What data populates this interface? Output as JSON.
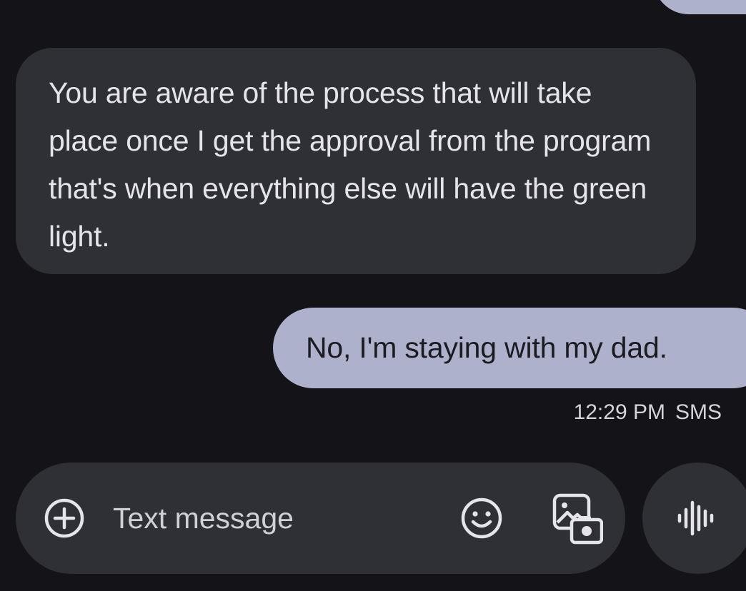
{
  "conversation": {
    "messages": [
      {
        "direction": "incoming",
        "text": "You are aware of the process that will take place once I get the approval from the program that's when everything else will have the green light."
      },
      {
        "direction": "outgoing",
        "text": "No, I'm staying with my dad."
      }
    ],
    "last_meta": {
      "time": "12:29 PM",
      "type": "SMS"
    }
  },
  "compose": {
    "placeholder": "Text message",
    "icons": {
      "add": "plus-circle-icon",
      "emoji": "emoji-icon",
      "gallery": "gallery-icon",
      "voice": "voice-waveform-icon"
    }
  },
  "colors": {
    "background": "#131318",
    "incoming_bubble": "#2f3036",
    "outgoing_bubble": "#aeb1cb",
    "text_light": "#e4e4ea",
    "text_dark": "#1b1c22"
  }
}
